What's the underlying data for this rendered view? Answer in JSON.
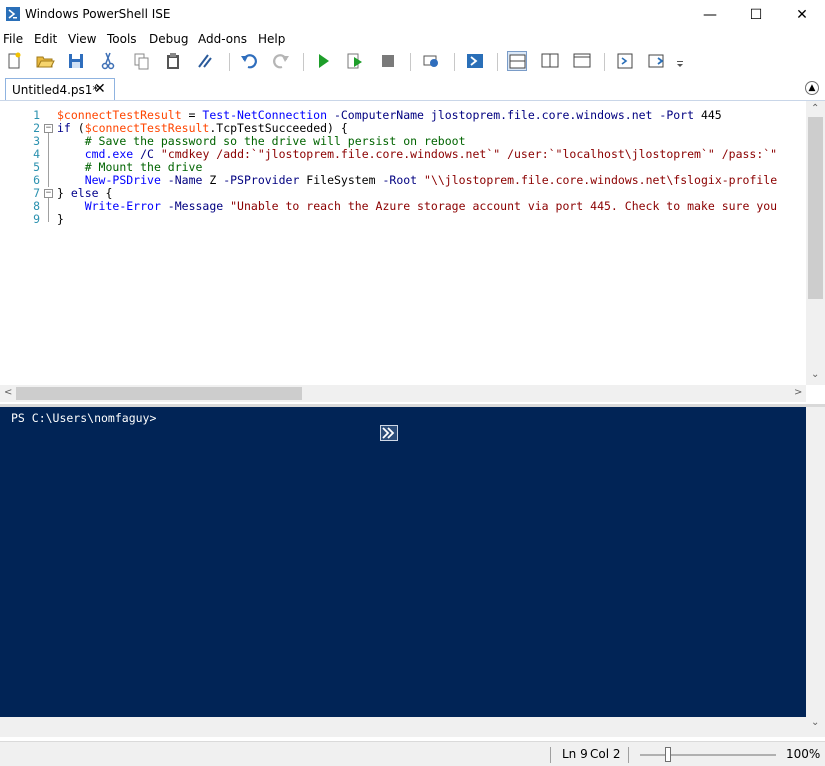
{
  "window": {
    "title": "Windows PowerShell ISE",
    "minimize": "—",
    "maximize": "☐",
    "close": "✕"
  },
  "menu": [
    "File",
    "Edit",
    "View",
    "Tools",
    "Debug",
    "Add-ons",
    "Help"
  ],
  "toolbar": {
    "icons": [
      "new-file-icon",
      "open-file-icon",
      "save-icon",
      "cut-icon",
      "copy-icon",
      "paste-icon",
      "clear-console-icon",
      "undo-icon",
      "redo-icon",
      "run-script-icon",
      "run-selection-icon",
      "stop-icon",
      "new-remote-tab-icon",
      "start-powershell-icon",
      "layout-top-icon",
      "layout-right-icon",
      "layout-maximized-icon",
      "show-script-pane-icon",
      "show-commands-icon",
      "toolbar-overflow-icon"
    ]
  },
  "tabs": [
    {
      "label": "Untitled4.ps1*",
      "close": "✕"
    }
  ],
  "collapse_glyph": "▲",
  "editor": {
    "line_numbers": [
      "1",
      "2",
      "3",
      "4",
      "5",
      "6",
      "7",
      "8",
      "9"
    ],
    "lines": [
      "$connectTestResult = Test-NetConnection -ComputerName jlostoprem.file.core.windows.net -Port 445",
      "if ($connectTestResult.TcpTestSucceeded) {",
      "    # Save the password so the drive will persist on reboot",
      "    cmd.exe /C \"cmdkey /add:`\"jlostoprem.file.core.windows.net`\" /user:`\"localhost\\jlostoprem`\" /pass:`\"",
      "    # Mount the drive",
      "    New-PSDrive -Name Z -PSProvider FileSystem -Root \"\\\\jlostoprem.file.core.windows.net\\fslogix-profile",
      "} else {",
      "    Write-Error -Message \"Unable to reach the Azure storage account via port 445. Check to make sure you",
      "}"
    ]
  },
  "console": {
    "prompt": "PS C:\\Users\\nomfaguy>"
  },
  "status": {
    "line": "Ln 9",
    "col": "Col 2",
    "zoom": "100%",
    "zoom_level": 0.2
  },
  "colors": {
    "console_bg": "#012456",
    "variable": "#ff4500",
    "command": "#0000ff",
    "parameter": "#000080",
    "string": "#8b0000",
    "comment": "#006400"
  }
}
